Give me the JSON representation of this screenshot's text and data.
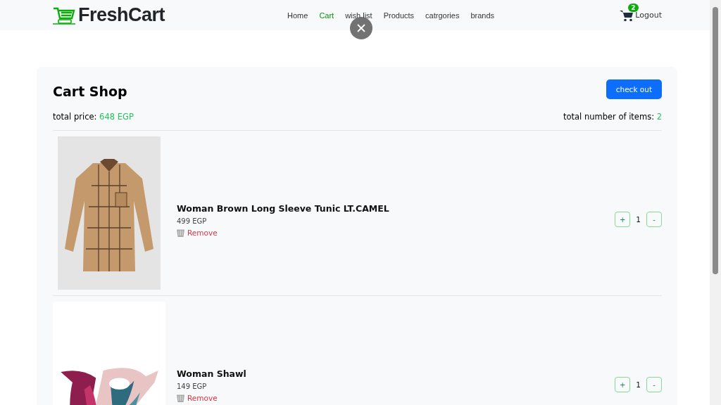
{
  "navbar": {
    "brand": "FreshCart",
    "links": [
      {
        "label": "Home",
        "selected": false
      },
      {
        "label": "Cart",
        "selected": true
      },
      {
        "label": "wish list",
        "selected": false
      },
      {
        "label": "Products",
        "selected": false
      },
      {
        "label": "catrgories",
        "selected": false
      },
      {
        "label": "brands",
        "selected": false
      }
    ],
    "cart_count": "2",
    "logout": "Logout"
  },
  "cart": {
    "title": "Cart Shop",
    "checkout": "check out",
    "total_price_label": "total price:",
    "total_price": "648 EGP",
    "total_items_label": "total number of items:",
    "total_items": "2",
    "items": [
      {
        "kind": "shirt",
        "name": "Woman Brown Long Sleeve Tunic LT.CAMEL",
        "price": "499 EGP",
        "remove": "Remove",
        "plus": "+",
        "quantity": "1",
        "minus": "-"
      },
      {
        "kind": "shawl",
        "name": "Woman Shawl",
        "price": "149 EGP",
        "remove": "Remove",
        "plus": "+",
        "quantity": "1",
        "minus": "-"
      }
    ]
  }
}
